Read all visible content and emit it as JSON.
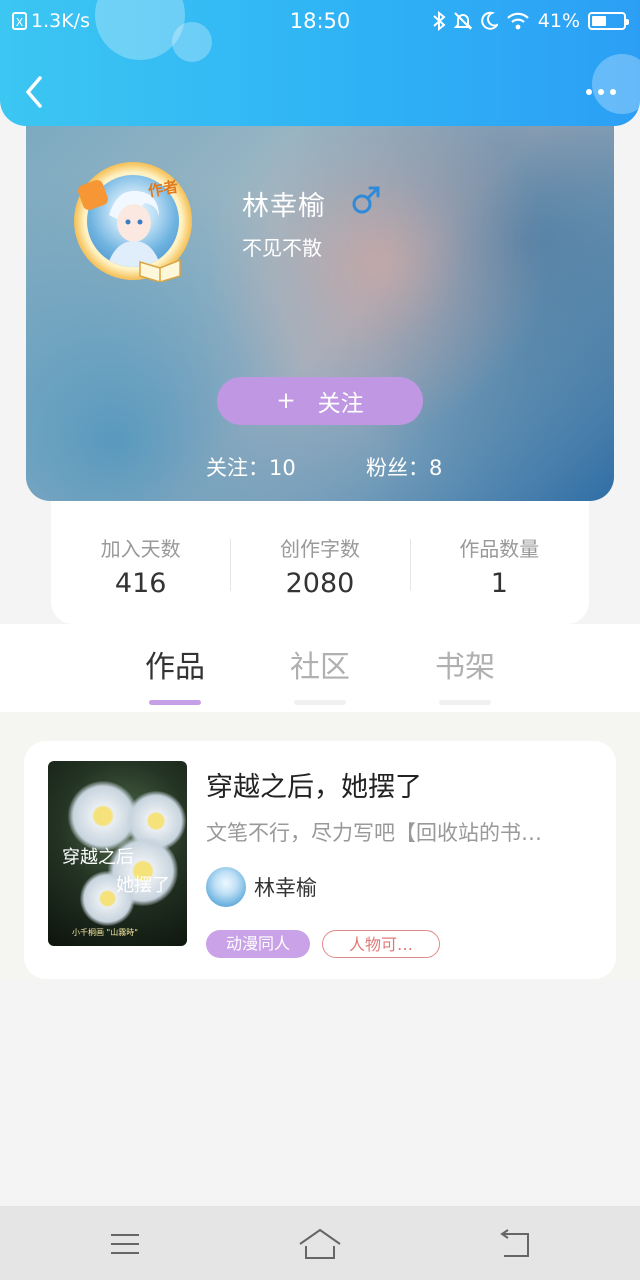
{
  "status_bar": {
    "net_speed": "1.3K/s",
    "time": "18:50",
    "battery": "41%"
  },
  "profile": {
    "name": "林幸榆",
    "bio": "不见不散",
    "author_badge": "作者",
    "follow_label": "关注",
    "following_text": "关注：10",
    "fans_text": "粉丝：8"
  },
  "summary": [
    {
      "label": "加入天数",
      "value": "416"
    },
    {
      "label": "创作字数",
      "value": "2080"
    },
    {
      "label": "作品数量",
      "value": "1"
    }
  ],
  "tabs": [
    {
      "label": "作品",
      "active": true
    },
    {
      "label": "社区",
      "active": false
    },
    {
      "label": "书架",
      "active": false
    }
  ],
  "book": {
    "title": "穿越之后，她摆了",
    "description": "文笔不行，尽力写吧【回收站的书…",
    "author": "林幸榆",
    "cover_title_line1": "穿越之后",
    "cover_title_line2": "她摆了",
    "cover_caption": "小千桐画 \"山霧時\"",
    "tags": [
      "动漫同人",
      "人物可…"
    ]
  },
  "colors": {
    "header": "#2fb3f5",
    "accent_purple": "#c097e2",
    "gender_blue": "#2f8ad8"
  }
}
